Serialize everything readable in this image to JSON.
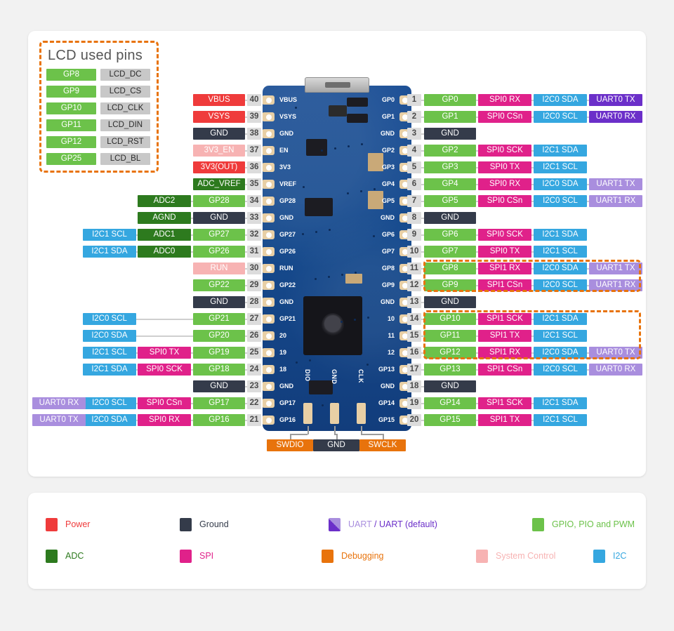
{
  "lcd_panel": {
    "title": "LCD used pins",
    "rows": [
      {
        "gp": "GP8",
        "fn": "LCD_DC"
      },
      {
        "gp": "GP9",
        "fn": "LCD_CS"
      },
      {
        "gp": "GP10",
        "fn": "LCD_CLK"
      },
      {
        "gp": "GP11",
        "fn": "LCD_DIN"
      },
      {
        "gp": "GP12",
        "fn": "LCD_RST"
      },
      {
        "gp": "GP25",
        "fn": "LCD_BL"
      }
    ]
  },
  "left_pins": [
    {
      "num": "40",
      "silk": "VBUS",
      "main": "VBUS",
      "main_type": "pwr",
      "fns": []
    },
    {
      "num": "39",
      "silk": "VSYS",
      "main": "VSYS",
      "main_type": "pwr",
      "fns": []
    },
    {
      "num": "38",
      "silk": "GND",
      "main": "GND",
      "main_type": "gnd",
      "fns": []
    },
    {
      "num": "37",
      "silk": "EN",
      "main": "3V3_EN",
      "main_type": "sys",
      "fns": []
    },
    {
      "num": "36",
      "silk": "3V3",
      "main": "3V3(OUT)",
      "main_type": "pwr",
      "fns": []
    },
    {
      "num": "35",
      "silk": "VREF",
      "main": "ADC_VREF",
      "main_type": "adc",
      "fns": []
    },
    {
      "num": "34",
      "silk": "GP28",
      "main": "GP28",
      "main_type": "gpio",
      "fns": [
        {
          "label": "ADC2",
          "type": "adc"
        }
      ]
    },
    {
      "num": "33",
      "silk": "GND",
      "main": "GND",
      "main_type": "gnd",
      "fns": [
        {
          "label": "AGND",
          "type": "adc"
        }
      ]
    },
    {
      "num": "32",
      "silk": "GP27",
      "main": "GP27",
      "main_type": "gpio",
      "fns": [
        {
          "label": "ADC1",
          "type": "adc"
        },
        {
          "label": "I2C1 SCL",
          "type": "i2c"
        }
      ]
    },
    {
      "num": "31",
      "silk": "GP26",
      "main": "GP26",
      "main_type": "gpio",
      "fns": [
        {
          "label": "ADC0",
          "type": "adc"
        },
        {
          "label": "I2C1 SDA",
          "type": "i2c"
        }
      ]
    },
    {
      "num": "30",
      "silk": "RUN",
      "main": "RUN",
      "main_type": "sys",
      "fns": []
    },
    {
      "num": "29",
      "silk": "GP22",
      "main": "GP22",
      "main_type": "gpio",
      "fns": []
    },
    {
      "num": "28",
      "silk": "GND",
      "main": "GND",
      "main_type": "gnd",
      "fns": []
    },
    {
      "num": "27",
      "silk": "GP21",
      "main": "GP21",
      "main_type": "gpio",
      "fns": [
        {
          "label": "",
          "type": "none"
        },
        {
          "label": "I2C0 SCL",
          "type": "i2c"
        }
      ]
    },
    {
      "num": "26",
      "silk": "20",
      "main": "GP20",
      "main_type": "gpio",
      "fns": [
        {
          "label": "",
          "type": "none"
        },
        {
          "label": "I2C0 SDA",
          "type": "i2c"
        }
      ]
    },
    {
      "num": "25",
      "silk": "19",
      "main": "GP19",
      "main_type": "gpio",
      "fns": [
        {
          "label": "SPI0 TX",
          "type": "spi"
        },
        {
          "label": "I2C1 SCL",
          "type": "i2c"
        }
      ]
    },
    {
      "num": "24",
      "silk": "18",
      "main": "GP18",
      "main_type": "gpio",
      "fns": [
        {
          "label": "SPI0 SCK",
          "type": "spi"
        },
        {
          "label": "I2C1 SDA",
          "type": "i2c"
        }
      ]
    },
    {
      "num": "23",
      "silk": "GND",
      "main": "GND",
      "main_type": "gnd",
      "fns": []
    },
    {
      "num": "22",
      "silk": "GP17",
      "main": "GP17",
      "main_type": "gpio",
      "fns": [
        {
          "label": "SPI0 CSn",
          "type": "spi"
        },
        {
          "label": "I2C0 SCL",
          "type": "i2c"
        },
        {
          "label": "UART0 RX",
          "type": "uart1"
        }
      ]
    },
    {
      "num": "21",
      "silk": "GP16",
      "main": "GP16",
      "main_type": "gpio",
      "fns": [
        {
          "label": "SPI0 RX",
          "type": "spi"
        },
        {
          "label": "I2C0 SDA",
          "type": "i2c"
        },
        {
          "label": "UART0 TX",
          "type": "uart1"
        }
      ]
    }
  ],
  "right_pins": [
    {
      "num": "1",
      "silk": "GP0",
      "main": "GP0",
      "main_type": "gpio",
      "fns": [
        {
          "label": "SPI0 RX",
          "type": "spi"
        },
        {
          "label": "I2C0 SDA",
          "type": "i2c"
        },
        {
          "label": "UART0 TX",
          "type": "uart0"
        }
      ]
    },
    {
      "num": "2",
      "silk": "GP1",
      "main": "GP1",
      "main_type": "gpio",
      "fns": [
        {
          "label": "SPI0 CSn",
          "type": "spi"
        },
        {
          "label": "I2C0 SCL",
          "type": "i2c"
        },
        {
          "label": "UART0 RX",
          "type": "uart0"
        }
      ]
    },
    {
      "num": "3",
      "silk": "GND",
      "main": "GND",
      "main_type": "gnd",
      "fns": []
    },
    {
      "num": "4",
      "silk": "GP2",
      "main": "GP2",
      "main_type": "gpio",
      "fns": [
        {
          "label": "SPI0 SCK",
          "type": "spi"
        },
        {
          "label": "I2C1 SDA",
          "type": "i2c"
        }
      ]
    },
    {
      "num": "5",
      "silk": "GP3",
      "main": "GP3",
      "main_type": "gpio",
      "fns": [
        {
          "label": "SPI0 TX",
          "type": "spi"
        },
        {
          "label": "I2C1 SCL",
          "type": "i2c"
        }
      ]
    },
    {
      "num": "6",
      "silk": "GP4",
      "main": "GP4",
      "main_type": "gpio",
      "fns": [
        {
          "label": "SPI0 RX",
          "type": "spi"
        },
        {
          "label": "I2C0 SDA",
          "type": "i2c"
        },
        {
          "label": "UART1 TX",
          "type": "uart1"
        }
      ]
    },
    {
      "num": "7",
      "silk": "GP5",
      "main": "GP5",
      "main_type": "gpio",
      "fns": [
        {
          "label": "SPI0 CSn",
          "type": "spi"
        },
        {
          "label": "I2C0 SCL",
          "type": "i2c"
        },
        {
          "label": "UART1 RX",
          "type": "uart1"
        }
      ]
    },
    {
      "num": "8",
      "silk": "GND",
      "main": "GND",
      "main_type": "gnd",
      "fns": []
    },
    {
      "num": "9",
      "silk": "GP6",
      "main": "GP6",
      "main_type": "gpio",
      "fns": [
        {
          "label": "SPI0 SCK",
          "type": "spi"
        },
        {
          "label": "I2C1 SDA",
          "type": "i2c"
        }
      ]
    },
    {
      "num": "10",
      "silk": "GP7",
      "main": "GP7",
      "main_type": "gpio",
      "fns": [
        {
          "label": "SPI0 TX",
          "type": "spi"
        },
        {
          "label": "I2C1 SCL",
          "type": "i2c"
        }
      ]
    },
    {
      "num": "11",
      "silk": "GP8",
      "main": "GP8",
      "main_type": "gpio",
      "fns": [
        {
          "label": "SPI1 RX",
          "type": "spi"
        },
        {
          "label": "I2C0 SDA",
          "type": "i2c"
        },
        {
          "label": "UART1 TX",
          "type": "uart1"
        }
      ]
    },
    {
      "num": "12",
      "silk": "GP9",
      "main": "GP9",
      "main_type": "gpio",
      "fns": [
        {
          "label": "SPI1 CSn",
          "type": "spi"
        },
        {
          "label": "I2C0 SCL",
          "type": "i2c"
        },
        {
          "label": "UART1 RX",
          "type": "uart1"
        }
      ]
    },
    {
      "num": "13",
      "silk": "GND",
      "main": "GND",
      "main_type": "gnd",
      "fns": []
    },
    {
      "num": "14",
      "silk": "10",
      "main": "GP10",
      "main_type": "gpio",
      "fns": [
        {
          "label": "SPI1 SCK",
          "type": "spi"
        },
        {
          "label": "I2C1 SDA",
          "type": "i2c"
        }
      ]
    },
    {
      "num": "15",
      "silk": "11",
      "main": "GP11",
      "main_type": "gpio",
      "fns": [
        {
          "label": "SPI1 TX",
          "type": "spi"
        },
        {
          "label": "I2C1 SCL",
          "type": "i2c"
        }
      ]
    },
    {
      "num": "16",
      "silk": "12",
      "main": "GP12",
      "main_type": "gpio",
      "fns": [
        {
          "label": "SPI1 RX",
          "type": "spi"
        },
        {
          "label": "I2C0 SDA",
          "type": "i2c"
        },
        {
          "label": "UART0 TX",
          "type": "uart1"
        }
      ]
    },
    {
      "num": "17",
      "silk": "GP13",
      "main": "GP13",
      "main_type": "gpio",
      "fns": [
        {
          "label": "SPI1 CSn",
          "type": "spi"
        },
        {
          "label": "I2C0 SCL",
          "type": "i2c"
        },
        {
          "label": "UART0 RX",
          "type": "uart1"
        }
      ]
    },
    {
      "num": "18",
      "silk": "GND",
      "main": "GND",
      "main_type": "gnd",
      "fns": []
    },
    {
      "num": "19",
      "silk": "GP14",
      "main": "GP14",
      "main_type": "gpio",
      "fns": [
        {
          "label": "SPI1 SCK",
          "type": "spi"
        },
        {
          "label": "I2C1 SDA",
          "type": "i2c"
        }
      ]
    },
    {
      "num": "20",
      "silk": "GP15",
      "main": "GP15",
      "main_type": "gpio",
      "fns": [
        {
          "label": "SPI1 TX",
          "type": "spi"
        },
        {
          "label": "I2C1 SCL",
          "type": "i2c"
        }
      ]
    }
  ],
  "debug_pins": [
    {
      "label": "SWDIO",
      "type": "debug",
      "silk": "DIO"
    },
    {
      "label": "GND",
      "type": "gnd",
      "silk": "GND"
    },
    {
      "label": "SWCLK",
      "type": "debug",
      "silk": "CLK"
    }
  ],
  "legend": [
    {
      "label": "Power",
      "color": "#ef3b3b",
      "text_color": "#ef3b3b"
    },
    {
      "label": "Ground",
      "color": "#343b4a",
      "text_color": "#343b4a"
    },
    {
      "label": "UART",
      "color": "#a98ede",
      "text_color": "#a98ede",
      "label2": " / UART (default)",
      "color2": "#6b2fc9",
      "split": true
    },
    {
      "label": "GPIO, PIO and PWM",
      "color": "#6cc24a",
      "text_color": "#6cc24a"
    },
    {
      "label": "ADC",
      "color": "#2d7a1e",
      "text_color": "#2d7a1e"
    },
    {
      "label": "SPI",
      "color": "#e0218a",
      "text_color": "#e0218a"
    },
    {
      "label": "Debugging",
      "color": "#e8730c",
      "text_color": "#e8730c"
    },
    {
      "label": "System Control",
      "color": "#f7b3b3",
      "text_color": "#f7b3b3"
    },
    {
      "label": "I2C",
      "color": "#35a7e0",
      "text_color": "#35a7e0"
    }
  ],
  "board_silk": {
    "swd_dio": "DIO",
    "swd_gnd": "GND",
    "swd_clk": "CLK"
  }
}
